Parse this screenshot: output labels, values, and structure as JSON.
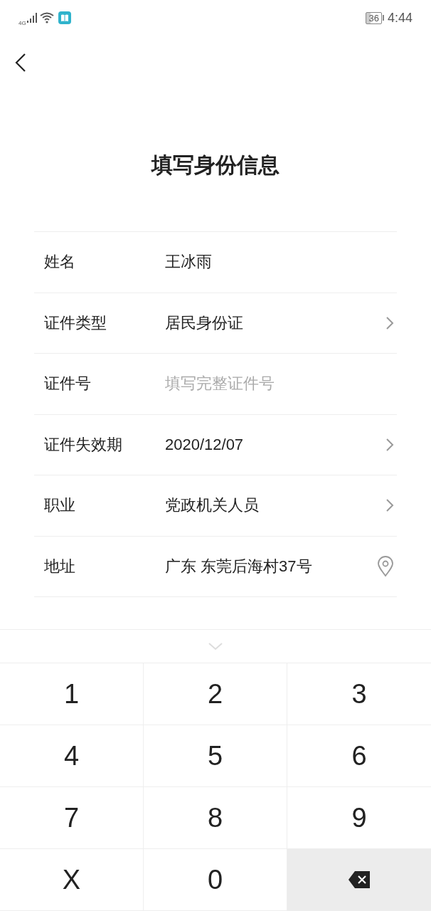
{
  "status_bar": {
    "network": "4G",
    "battery": "36",
    "time": "4:44"
  },
  "title": "填写身份信息",
  "fields": [
    {
      "kind": "plain",
      "label": "姓名",
      "value": "王冰雨"
    },
    {
      "kind": "chevron",
      "label": "证件类型",
      "value": "居民身份证"
    },
    {
      "kind": "plain",
      "label": "证件号",
      "placeholder": "填写完整证件号"
    },
    {
      "kind": "chevron",
      "label": "证件失效期",
      "value": "2020/12/07"
    },
    {
      "kind": "chevron",
      "label": "职业",
      "value": "党政机关人员"
    },
    {
      "kind": "location",
      "label": "地址",
      "value": "广东 东莞后海村37号"
    }
  ],
  "keypad": [
    {
      "kind": "digit",
      "label": "1"
    },
    {
      "kind": "digit",
      "label": "2"
    },
    {
      "kind": "digit",
      "label": "3"
    },
    {
      "kind": "digit",
      "label": "4"
    },
    {
      "kind": "digit",
      "label": "5"
    },
    {
      "kind": "digit",
      "label": "6"
    },
    {
      "kind": "digit",
      "label": "7"
    },
    {
      "kind": "digit",
      "label": "8"
    },
    {
      "kind": "digit",
      "label": "9"
    },
    {
      "kind": "digit",
      "label": "X"
    },
    {
      "kind": "digit",
      "label": "0"
    },
    {
      "kind": "backspace"
    }
  ]
}
